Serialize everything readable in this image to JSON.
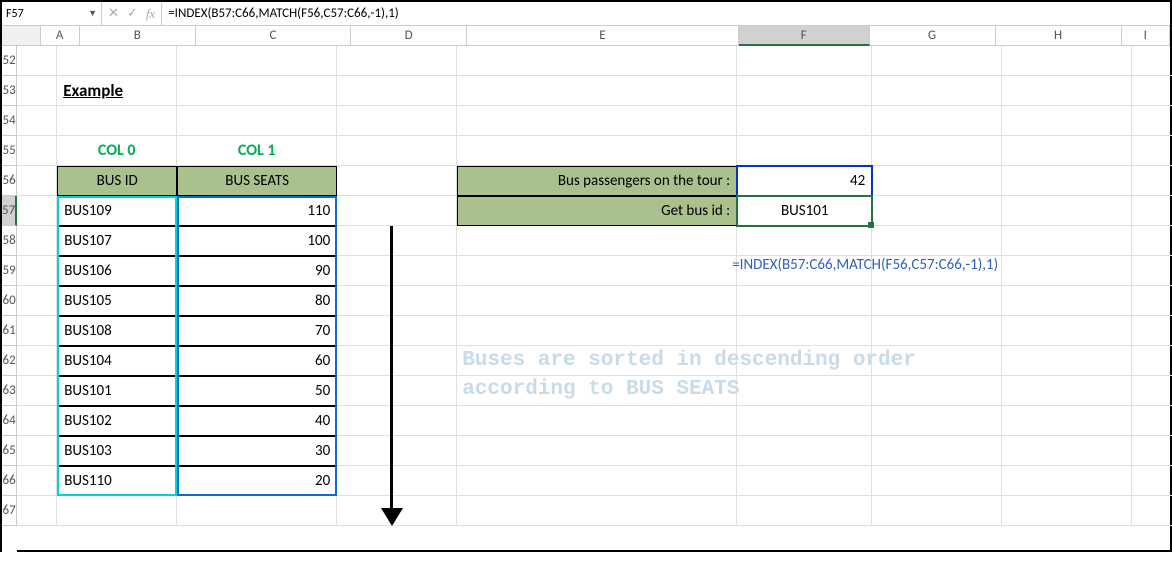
{
  "namebox": "F57",
  "formula_bar": "=INDEX(B57:C66,MATCH(F56,C57:C66,-1),1)",
  "columns": [
    "A",
    "B",
    "C",
    "D",
    "E",
    "F",
    "G",
    "H",
    "I"
  ],
  "active_col": "F",
  "rows": [
    "52",
    "53",
    "54",
    "55",
    "56",
    "57",
    "58",
    "59",
    "60",
    "61",
    "62",
    "63",
    "64",
    "65",
    "66",
    "67"
  ],
  "active_row": "57",
  "example_label": "Example",
  "col0_label": "COL 0",
  "col1_label": "COL 1",
  "table": {
    "head_b": "BUS ID",
    "head_c": "BUS SEATS",
    "rows": [
      {
        "b": "BUS109",
        "c": "110"
      },
      {
        "b": "BUS107",
        "c": "100"
      },
      {
        "b": "BUS106",
        "c": "90"
      },
      {
        "b": "BUS105",
        "c": "80"
      },
      {
        "b": "BUS108",
        "c": "70"
      },
      {
        "b": "BUS104",
        "c": "60"
      },
      {
        "b": "BUS101",
        "c": "50"
      },
      {
        "b": "BUS102",
        "c": "40"
      },
      {
        "b": "BUS103",
        "c": "30"
      },
      {
        "b": "BUS110",
        "c": "20"
      }
    ]
  },
  "side": {
    "label1": "Bus passengers on the tour :",
    "val1": "42",
    "label2": "Get bus id :",
    "val2": "BUS101"
  },
  "formula_note": "=INDEX(B57:C66,MATCH(F56,C57:C66,-1),1)",
  "big_note": "Buses are sorted in descending order\naccording to BUS SEATS"
}
